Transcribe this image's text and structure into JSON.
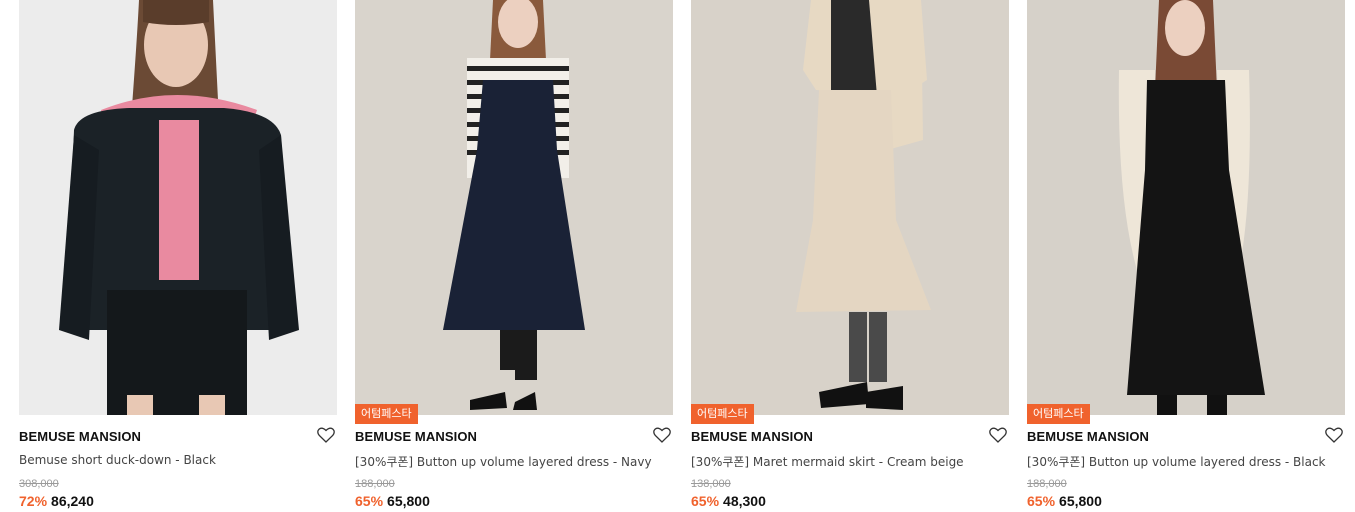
{
  "products": [
    {
      "badge": "",
      "brand": "BEMUSE MANSION",
      "name": "Bemuse short duck-down - Black",
      "original_price": "308,000",
      "discount": "72%",
      "price": "86,240",
      "wishlist_icon": "heart-outline-icon"
    },
    {
      "badge": "어텀페스타",
      "brand": "BEMUSE MANSION",
      "name": "[30%쿠폰] Button up volume layered dress - Navy",
      "original_price": "188,000",
      "discount": "65%",
      "price": "65,800",
      "wishlist_icon": "heart-outline-icon"
    },
    {
      "badge": "어텀페스타",
      "brand": "BEMUSE MANSION",
      "name": "[30%쿠폰] Maret mermaid skirt - Cream beige",
      "original_price": "138,000",
      "discount": "65%",
      "price": "48,300",
      "wishlist_icon": "heart-outline-icon"
    },
    {
      "badge": "어텀페스타",
      "brand": "BEMUSE MANSION",
      "name": "[30%쿠폰] Button up volume layered dress - Black",
      "original_price": "188,000",
      "discount": "65%",
      "price": "65,800",
      "wishlist_icon": "heart-outline-icon"
    }
  ],
  "colors": {
    "accent": "#f0622d",
    "strike": "#9a9a9a",
    "photo_bg_1": "#e9e9e9",
    "photo_bg_2": "#d6d0c6"
  }
}
